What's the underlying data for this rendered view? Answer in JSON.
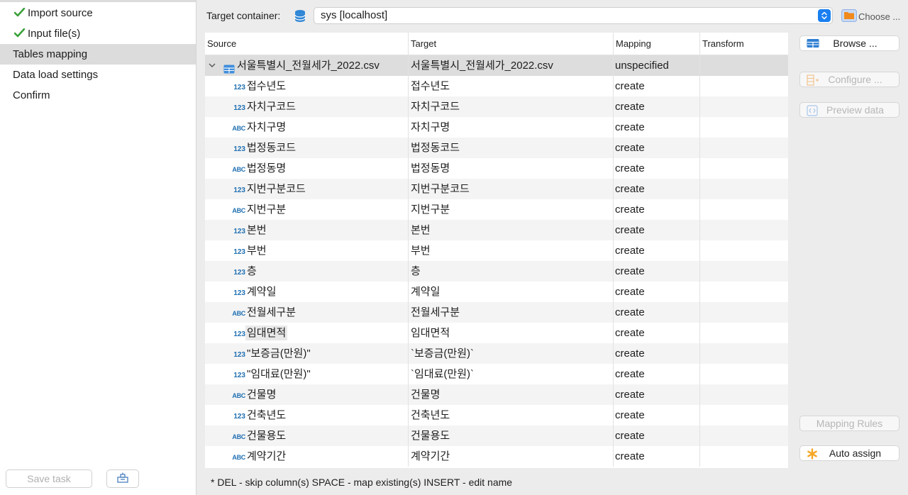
{
  "sidebar": {
    "steps": [
      {
        "label": "Import source",
        "done": true
      },
      {
        "label": "Input file(s)",
        "done": true
      },
      {
        "label": "Tables mapping",
        "active": true
      },
      {
        "label": "Data load settings"
      },
      {
        "label": "Confirm"
      }
    ],
    "save_task_label": "Save task"
  },
  "header": {
    "target_label": "Target container:",
    "target_value": "sys  [localhost]",
    "choose_label": "Choose ..."
  },
  "table": {
    "columns": [
      "Source",
      "Target",
      "Mapping",
      "Transform"
    ],
    "file_row": {
      "source": "서울특별시_전월세가_2022.csv",
      "target": "서울특별시_전월세가_2022.csv",
      "mapping": "unspecified",
      "transform": ""
    },
    "rows": [
      {
        "type": "123",
        "source": "접수년도",
        "target": "접수년도",
        "mapping": "create"
      },
      {
        "type": "123",
        "source": "자치구코드",
        "target": "자치구코드",
        "mapping": "create"
      },
      {
        "type": "ABC",
        "source": "자치구명",
        "target": "자치구명",
        "mapping": "create"
      },
      {
        "type": "123",
        "source": "법정동코드",
        "target": "법정동코드",
        "mapping": "create"
      },
      {
        "type": "ABC",
        "source": "법정동명",
        "target": "법정동명",
        "mapping": "create"
      },
      {
        "type": "123",
        "source": "지번구분코드",
        "target": "지번구분코드",
        "mapping": "create"
      },
      {
        "type": "ABC",
        "source": "지번구분",
        "target": "지번구분",
        "mapping": "create"
      },
      {
        "type": "123",
        "source": "본번",
        "target": "본번",
        "mapping": "create"
      },
      {
        "type": "123",
        "source": "부번",
        "target": "부번",
        "mapping": "create"
      },
      {
        "type": "123",
        "source": "층",
        "target": "층",
        "mapping": "create"
      },
      {
        "type": "123",
        "source": "계약일",
        "target": "계약일",
        "mapping": "create"
      },
      {
        "type": "ABC",
        "source": "전월세구분",
        "target": "전월세구분",
        "mapping": "create"
      },
      {
        "type": "123",
        "source": "임대면적",
        "target": "임대면적",
        "mapping": "create"
      },
      {
        "type": "123",
        "source": "\"보증금(만원)\"",
        "target": "`보증금(만원)`",
        "mapping": "create"
      },
      {
        "type": "123",
        "source": "\"임대료(만원)\"",
        "target": "`임대료(만원)`",
        "mapping": "create"
      },
      {
        "type": "ABC",
        "source": "건물명",
        "target": "건물명",
        "mapping": "create"
      },
      {
        "type": "123",
        "source": "건축년도",
        "target": "건축년도",
        "mapping": "create"
      },
      {
        "type": "ABC",
        "source": "건물용도",
        "target": "건물용도",
        "mapping": "create"
      },
      {
        "type": "ABC",
        "source": "계약기간",
        "target": "계약기간",
        "mapping": "create"
      }
    ]
  },
  "buttons": {
    "browse": "Browse ...",
    "configure": "Configure ...",
    "preview": "Preview data",
    "mapping_rules": "Mapping Rules",
    "auto_assign": "Auto assign"
  },
  "footer_hint": "* DEL - skip column(s)  SPACE - map existing(s)  INSERT - edit name",
  "colors": {
    "accent": "#1a7ff0",
    "type_badge": "#1f6fb2",
    "check": "#3aa03a",
    "folder": "#f08a1c"
  }
}
